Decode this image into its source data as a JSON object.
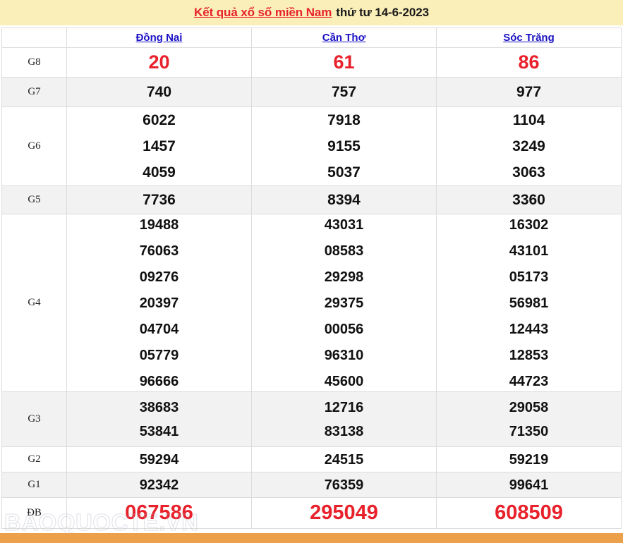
{
  "header": {
    "title_main": "Kết quả xổ số miền Nam",
    "title_date": "thứ tư 14-6-2023",
    "banner_color": "#faeeb9",
    "title_color": "#e8212b"
  },
  "table": {
    "corner_label": "",
    "columns": [
      "Đồng Nai",
      "Cần Thơ",
      "Sóc Trăng"
    ],
    "prize_color_highlight": "#e8212b",
    "rows": [
      {
        "label": "G8",
        "highlight": true,
        "cells": [
          [
            "20"
          ],
          [
            "61"
          ],
          [
            "86"
          ]
        ]
      },
      {
        "label": "G7",
        "highlight": false,
        "cells": [
          [
            "740"
          ],
          [
            "757"
          ],
          [
            "977"
          ]
        ]
      },
      {
        "label": "G6",
        "highlight": false,
        "cells": [
          [
            "6022",
            "1457",
            "4059"
          ],
          [
            "7918",
            "9155",
            "5037"
          ],
          [
            "1104",
            "3249",
            "3063"
          ]
        ]
      },
      {
        "label": "G5",
        "highlight": false,
        "cells": [
          [
            "7736"
          ],
          [
            "8394"
          ],
          [
            "3360"
          ]
        ]
      },
      {
        "label": "G4",
        "highlight": false,
        "cells": [
          [
            "19488",
            "76063",
            "09276",
            "20397",
            "04704",
            "05779",
            "96666"
          ],
          [
            "43031",
            "08583",
            "29298",
            "29375",
            "00056",
            "96310",
            "45600"
          ],
          [
            "16302",
            "43101",
            "05173",
            "56981",
            "12443",
            "12853",
            "44723"
          ]
        ]
      },
      {
        "label": "G3",
        "highlight": false,
        "cells": [
          [
            "38683",
            "53841"
          ],
          [
            "12716",
            "83138"
          ],
          [
            "29058",
            "71350"
          ]
        ]
      },
      {
        "label": "G2",
        "highlight": false,
        "cells": [
          [
            "59294"
          ],
          [
            "24515"
          ],
          [
            "59219"
          ]
        ]
      },
      {
        "label": "G1",
        "highlight": false,
        "cells": [
          [
            "92342"
          ],
          [
            "76359"
          ],
          [
            "99641"
          ]
        ]
      },
      {
        "label": "ĐB",
        "highlight": true,
        "cells": [
          [
            "067586"
          ],
          [
            "295049"
          ],
          [
            "608509"
          ]
        ]
      }
    ]
  },
  "watermark": {
    "text": "BAOQUOCTE.VN"
  },
  "bottom_bar": {
    "left_text": "",
    "right_text": "",
    "color": "#eda04a"
  }
}
